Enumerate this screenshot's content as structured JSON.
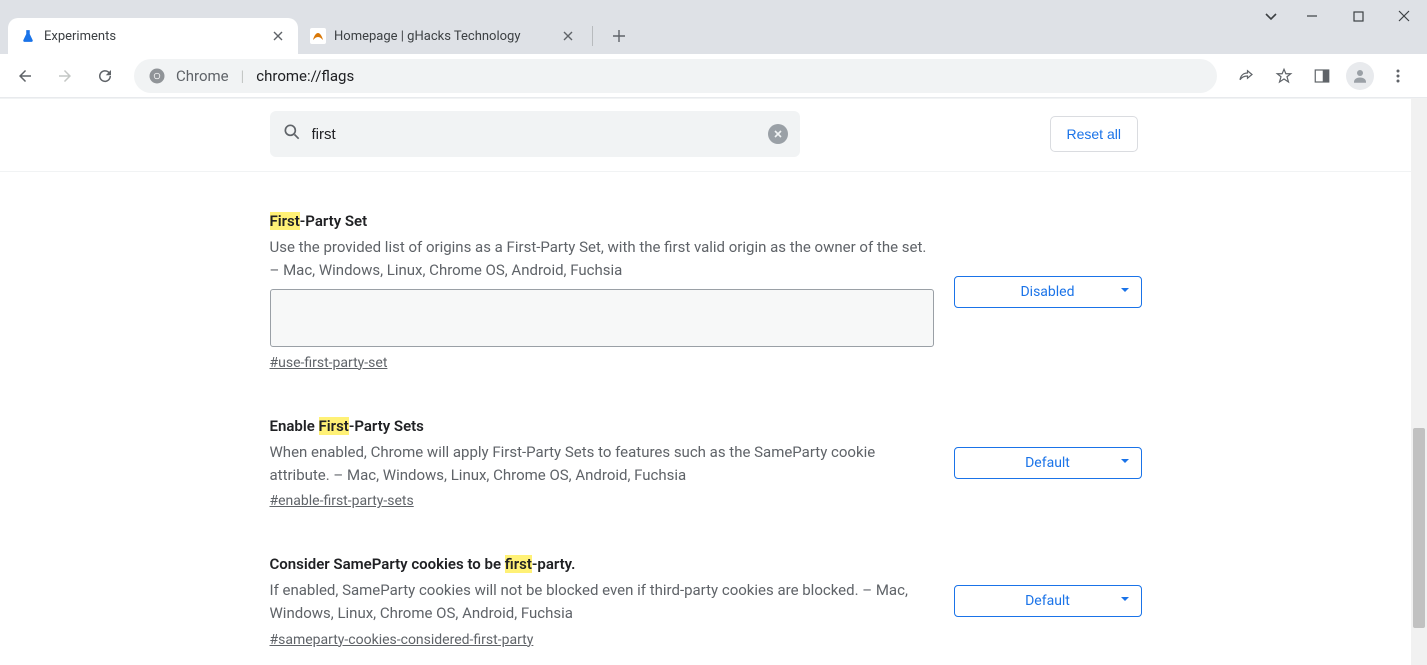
{
  "window": {
    "tabs": [
      {
        "title": "Experiments",
        "favicon": "flask",
        "active": true
      },
      {
        "title": "Homepage | gHacks Technology",
        "favicon": "ghacks",
        "active": false
      }
    ]
  },
  "toolbar": {
    "omnibox": {
      "origin": "Chrome",
      "path": "chrome://flags"
    }
  },
  "page": {
    "search_value": "first",
    "reset_label": "Reset all",
    "highlight": "first",
    "flags": [
      {
        "title": "First-Party Set",
        "description": "Use the provided list of origins as a First-Party Set, with the first valid origin as the owner of the set. – Mac, Windows, Linux, Chrome OS, Android, Fuchsia",
        "anchor": "#use-first-party-set",
        "has_textarea": true,
        "select_value": "Disabled"
      },
      {
        "title": "Enable First-Party Sets",
        "description": "When enabled, Chrome will apply First-Party Sets to features such as the SameParty cookie attribute. – Mac, Windows, Linux, Chrome OS, Android, Fuchsia",
        "anchor": "#enable-first-party-sets",
        "has_textarea": false,
        "select_value": "Default"
      },
      {
        "title": "Consider SameParty cookies to be first-party.",
        "description": "If enabled, SameParty cookies will not be blocked even if third-party cookies are blocked. – Mac, Windows, Linux, Chrome OS, Android, Fuchsia",
        "anchor": "#sameparty-cookies-considered-first-party",
        "has_textarea": false,
        "select_value": "Default"
      }
    ]
  }
}
